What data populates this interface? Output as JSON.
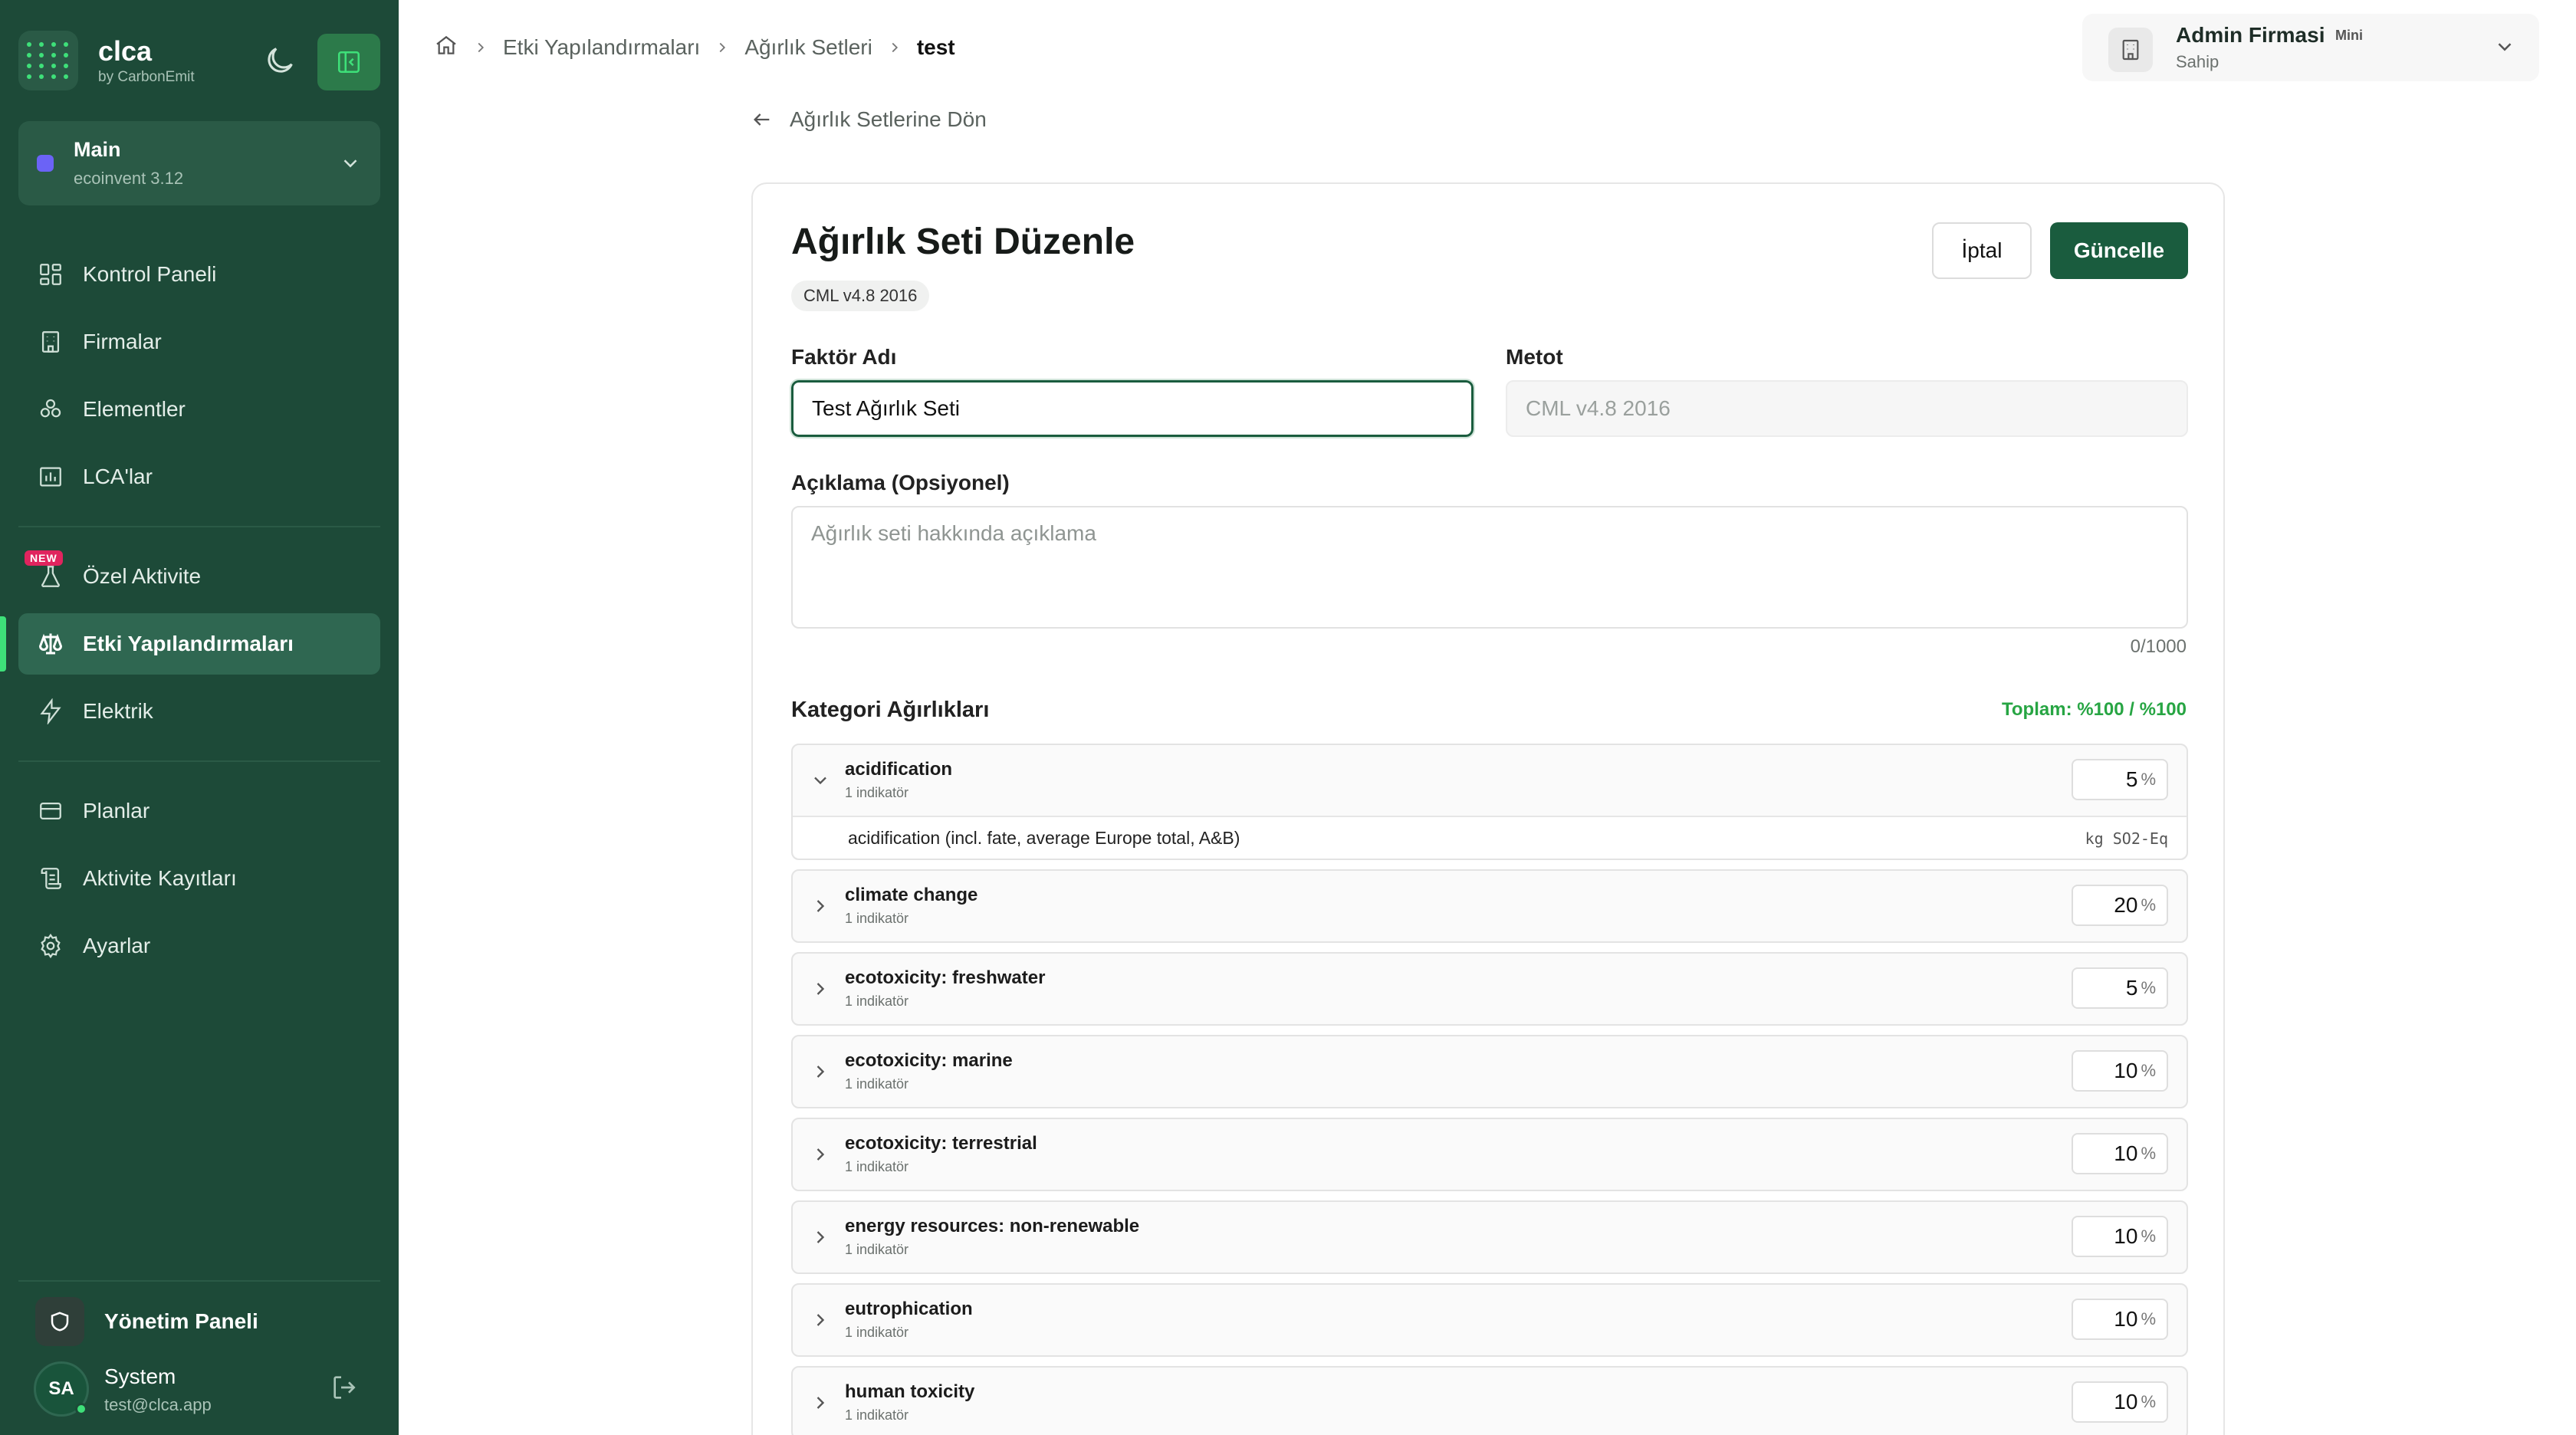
{
  "brand": {
    "name": "clca",
    "sub": "by CarbonEmit"
  },
  "workspace": {
    "name": "Main",
    "sub": "ecoinvent 3.12"
  },
  "nav": {
    "dashboard": "Kontrol Paneli",
    "companies": "Firmalar",
    "elements": "Elementler",
    "lcas": "LCA'lar",
    "custom_activity": "Özel Aktivite",
    "new_badge": "NEW",
    "impact_configs": "Etki Yapılandırmaları",
    "electricity": "Elektrik",
    "plans": "Planlar",
    "activity_logs": "Aktivite Kayıtları",
    "settings": "Ayarlar"
  },
  "admin_panel": "Yönetim Paneli",
  "user": {
    "initials": "SA",
    "name": "System",
    "email": "test@clca.app"
  },
  "breadcrumb": {
    "level1": "Etki Yapılandırmaları",
    "level2": "Ağırlık Setleri",
    "current": "test"
  },
  "org": {
    "name": "Admin Firmasi",
    "plan": "Mini",
    "role": "Sahip"
  },
  "back_link": "Ağırlık Setlerine Dön",
  "form": {
    "title": "Ağırlık Seti Düzenle",
    "method_pill": "CML v4.8 2016",
    "cancel": "İptal",
    "update": "Güncelle",
    "name_label": "Faktör Adı",
    "name_value": "Test Ağırlık Seti",
    "method_label": "Metot",
    "method_value": "CML v4.8 2016",
    "desc_label": "Açıklama (Opsiyonel)",
    "desc_placeholder": "Ağırlık seti hakkında açıklama",
    "desc_counter": "0/1000",
    "categories_title": "Kategori Ağırlıkları",
    "total": "Toplam: %100 / %100"
  },
  "categories": [
    {
      "name": "acidification",
      "sub": "1 indikatör",
      "value": "5",
      "unit": "%",
      "detail": "acidification (incl. fate, average Europe total, A&B)",
      "detail_unit": "kg SO2-Eq"
    },
    {
      "name": "climate change",
      "sub": "1 indikatör",
      "value": "20",
      "unit": "%"
    },
    {
      "name": "ecotoxicity: freshwater",
      "sub": "1 indikatör",
      "value": "5",
      "unit": "%"
    },
    {
      "name": "ecotoxicity: marine",
      "sub": "1 indikatör",
      "value": "10",
      "unit": "%"
    },
    {
      "name": "ecotoxicity: terrestrial",
      "sub": "1 indikatör",
      "value": "10",
      "unit": "%"
    },
    {
      "name": "energy resources: non-renewable",
      "sub": "1 indikatör",
      "value": "10",
      "unit": "%"
    },
    {
      "name": "eutrophication",
      "sub": "1 indikatör",
      "value": "10",
      "unit": "%"
    },
    {
      "name": "human toxicity",
      "sub": "1 indikatör",
      "value": "10",
      "unit": "%"
    }
  ]
}
